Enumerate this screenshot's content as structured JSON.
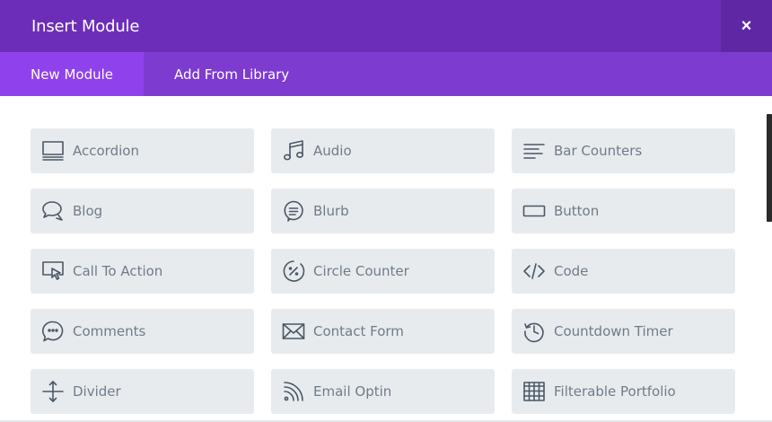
{
  "dialog": {
    "title": "Insert Module",
    "close_label": "×"
  },
  "tabs": [
    {
      "label": "New Module",
      "active": true
    },
    {
      "label": "Add From Library",
      "active": false
    }
  ],
  "modules": [
    {
      "label": "Accordion",
      "icon": "accordion-icon"
    },
    {
      "label": "Audio",
      "icon": "music-note-icon"
    },
    {
      "label": "Bar Counters",
      "icon": "bar-counters-icon"
    },
    {
      "label": "Blog",
      "icon": "chat-bubbles-icon"
    },
    {
      "label": "Blurb",
      "icon": "speech-bubble-icon"
    },
    {
      "label": "Button",
      "icon": "button-rectangle-icon"
    },
    {
      "label": "Call To Action",
      "icon": "cursor-screen-icon"
    },
    {
      "label": "Circle Counter",
      "icon": "circle-percent-icon"
    },
    {
      "label": "Code",
      "icon": "code-brackets-icon"
    },
    {
      "label": "Comments",
      "icon": "comment-dots-icon"
    },
    {
      "label": "Contact Form",
      "icon": "envelope-icon"
    },
    {
      "label": "Countdown Timer",
      "icon": "history-clock-icon"
    },
    {
      "label": "Divider",
      "icon": "divider-arrows-icon"
    },
    {
      "label": "Email Optin",
      "icon": "rss-icon"
    },
    {
      "label": "Filterable Portfolio",
      "icon": "grid-table-icon"
    }
  ],
  "colors": {
    "header_bg": "#6c2eb9",
    "tabbar_bg": "#7e3bd0",
    "active_tab_bg": "#8f42ec",
    "module_bg": "#e8ebee"
  }
}
